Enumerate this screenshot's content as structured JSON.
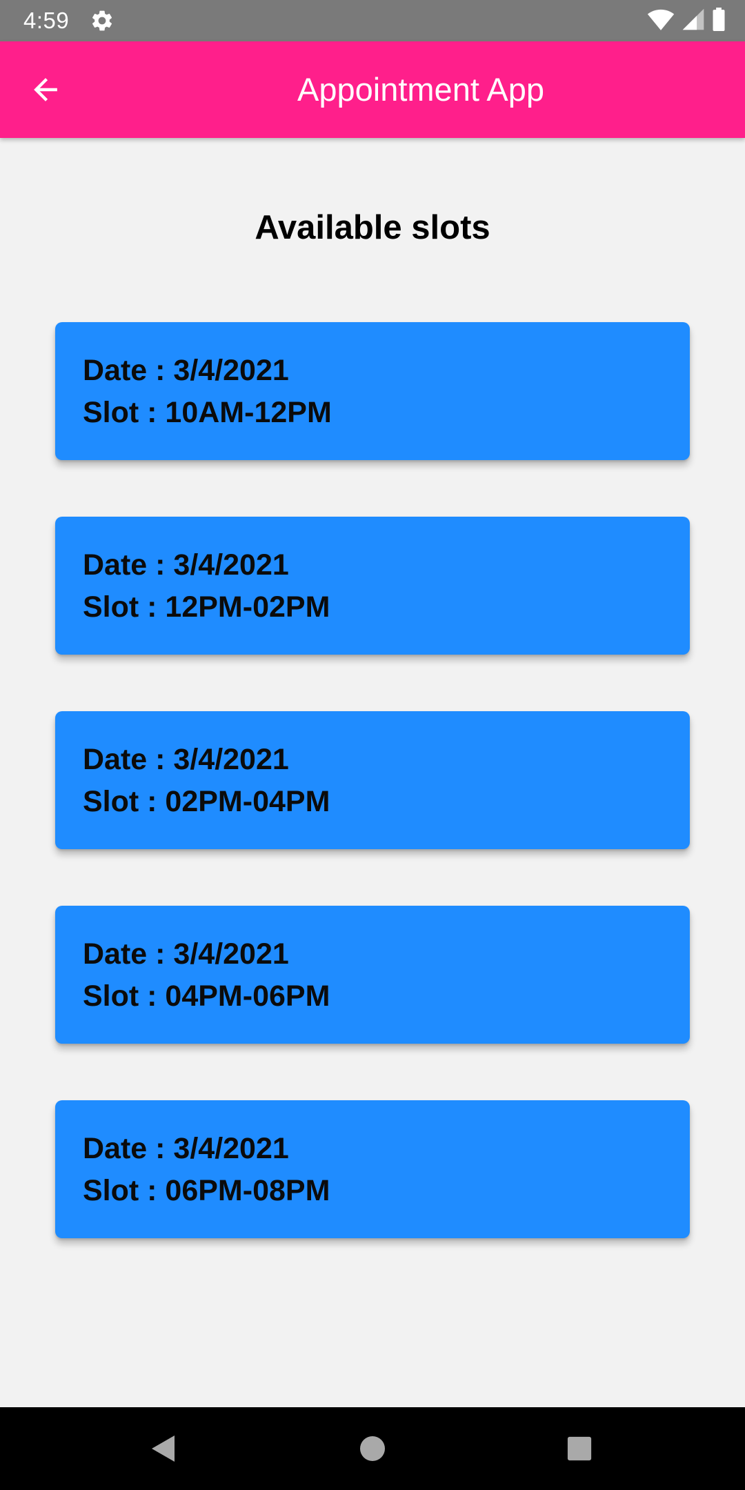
{
  "status_bar": {
    "time": "4:59",
    "icons": [
      "gear-icon",
      "wifi-icon",
      "signal-icon",
      "battery-icon"
    ]
  },
  "app_bar": {
    "title": "Appointment App",
    "back_icon": "arrow-left-icon"
  },
  "main": {
    "heading": "Available slots",
    "slots": [
      {
        "date_text": "Date : 3/4/2021",
        "slot_text": "Slot : 10AM-12PM"
      },
      {
        "date_text": "Date : 3/4/2021",
        "slot_text": "Slot : 12PM-02PM"
      },
      {
        "date_text": "Date : 3/4/2021",
        "slot_text": "Slot : 02PM-04PM"
      },
      {
        "date_text": "Date : 3/4/2021",
        "slot_text": "Slot : 04PM-06PM"
      },
      {
        "date_text": "Date : 3/4/2021",
        "slot_text": "Slot : 06PM-08PM"
      }
    ]
  },
  "nav_bar": {
    "icons": [
      "nav-back-icon",
      "nav-home-icon",
      "nav-recents-icon"
    ]
  },
  "colors": {
    "status_bar": "#7a7a7a",
    "app_bar": "#ff1f8b",
    "card": "#1f8cff",
    "background": "#f2f2f2",
    "nav_bar": "#000000"
  }
}
